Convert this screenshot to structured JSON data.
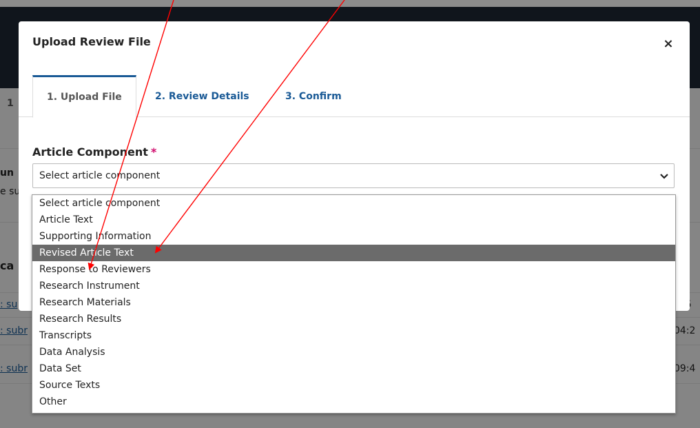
{
  "background": {
    "row_labels": [
      "1",
      "un",
      "e su",
      "ca"
    ],
    "link_texts": [
      ": su",
      ": subr",
      ": subr"
    ],
    "timestamps": [
      ":5",
      "04:2",
      "09:4"
    ]
  },
  "modal": {
    "title": "Upload Review File",
    "close_icon": "close-icon",
    "tabs": [
      {
        "label": "1. Upload File",
        "active": true
      },
      {
        "label": "2. Review Details",
        "active": false
      },
      {
        "label": "3. Confirm",
        "active": false
      }
    ],
    "field_label": "Article Component",
    "required_marker": "*",
    "select": {
      "selected": "Select article component",
      "chevron_icon": "chevron-down-icon"
    }
  },
  "dropdown": {
    "highlighted_index": 3,
    "options": [
      "Select article component",
      "Article Text",
      "Supporting Information",
      "Revised Article Text",
      "Response to Reviewers",
      "Research Instrument",
      "Research Materials",
      "Research Results",
      "Transcripts",
      "Data Analysis",
      "Data Set",
      "Source Texts",
      "Other"
    ]
  },
  "colors": {
    "accent": "#1a5a96",
    "required": "#d00a6c",
    "header_bg": "#1e2733",
    "highlight_bg": "#6b6b6b",
    "annotation_arrow": "#ff0000"
  }
}
